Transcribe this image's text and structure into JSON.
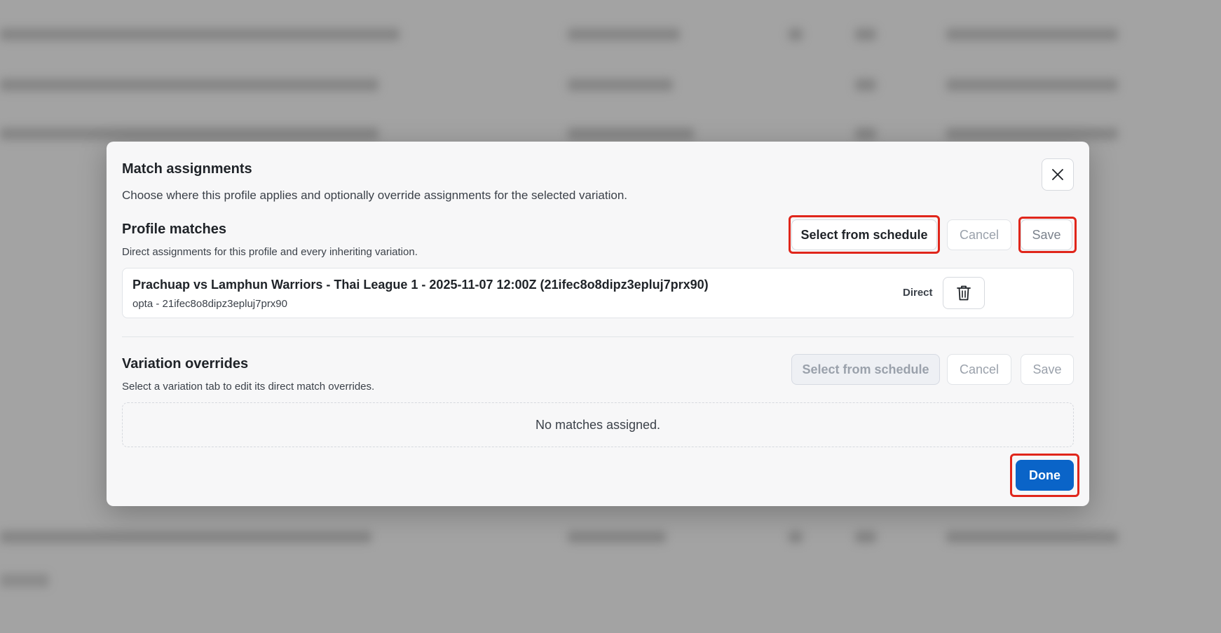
{
  "modal": {
    "title": "Match assignments",
    "subtitle": "Choose where this profile applies and optionally override assignments for the selected variation.",
    "close_icon": "close-icon"
  },
  "profile_matches": {
    "title": "Profile matches",
    "description": "Direct assignments for this profile and every inheriting variation.",
    "select_label": "Select from schedule",
    "cancel_label": "Cancel",
    "save_label": "Save",
    "matches": [
      {
        "title": "Prachuap vs Lamphun Warriors - Thai League 1 - 2025-11-07 12:00Z (21ifec8o8dipz3epluj7prx90)",
        "subtitle": "opta - 21ifec8o8dipz3epluj7prx90",
        "tag": "Direct",
        "delete_icon": "trash-icon"
      }
    ]
  },
  "variation_overrides": {
    "title": "Variation overrides",
    "description": "Select a variation tab to edit its direct match overrides.",
    "select_label": "Select from schedule",
    "cancel_label": "Cancel",
    "save_label": "Save",
    "empty_text": "No matches assigned."
  },
  "footer": {
    "done_label": "Done"
  },
  "colors": {
    "primary": "#0a64c8",
    "highlight": "#e0261b",
    "overlay": "#a3a3a3"
  }
}
